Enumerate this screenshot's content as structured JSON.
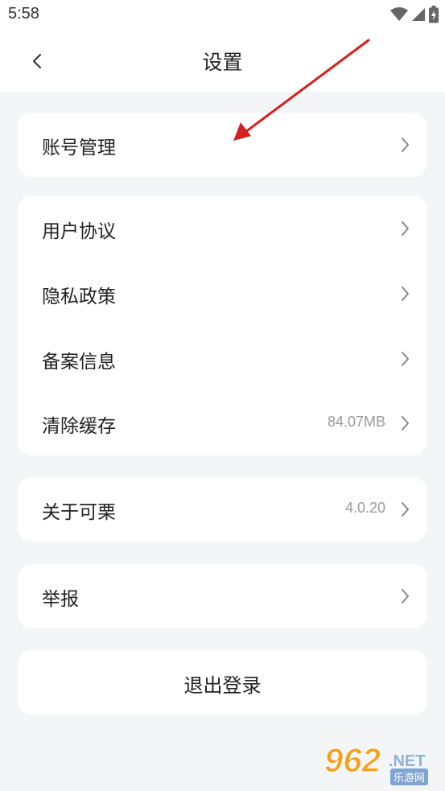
{
  "status_bar": {
    "time": "5:58",
    "icons": [
      "wifi-icon",
      "signal-icon",
      "battery-icon"
    ]
  },
  "header": {
    "title": "设置",
    "back_icon": "chevron-left-icon"
  },
  "groups": [
    {
      "rows": [
        {
          "label": "账号管理",
          "value": ""
        }
      ]
    },
    {
      "rows": [
        {
          "label": "用户协议",
          "value": ""
        },
        {
          "label": "隐私政策",
          "value": ""
        },
        {
          "label": "备案信息",
          "value": ""
        },
        {
          "label": "清除缓存",
          "value": "84.07MB"
        }
      ]
    },
    {
      "rows": [
        {
          "label": "关于可栗",
          "value": "4.0.20"
        }
      ]
    },
    {
      "rows": [
        {
          "label": "举报",
          "value": ""
        }
      ]
    }
  ],
  "logout": {
    "label": "退出登录"
  },
  "watermark": {
    "number": "962",
    "suffix": ".NET",
    "cn": "乐游网"
  },
  "colors": {
    "background": "#f4f5f7",
    "card": "#ffffff",
    "annotation_arrow": "#d42020",
    "watermark_orange": "#f3a21f"
  }
}
